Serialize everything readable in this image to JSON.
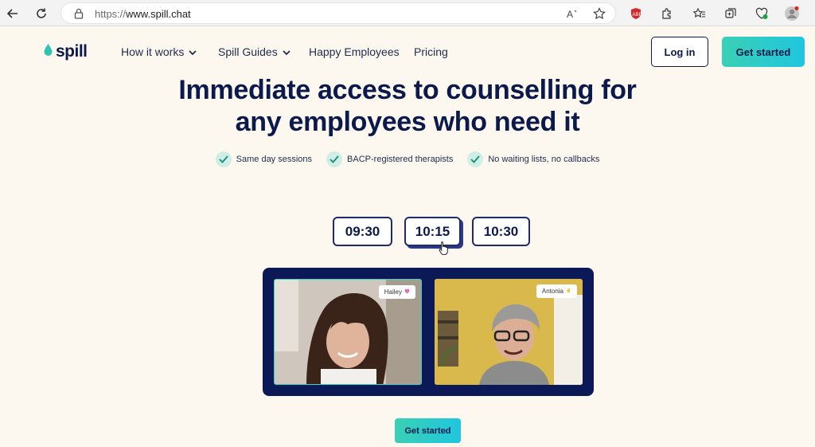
{
  "browser": {
    "url_protocol": "https://",
    "url_host": "www.spill.chat"
  },
  "site": {
    "logo_text": "spill",
    "nav": [
      {
        "label": "How it works",
        "has_dropdown": true
      },
      {
        "label": "Spill Guides",
        "has_dropdown": true
      },
      {
        "label": "Happy Employees",
        "has_dropdown": false
      },
      {
        "label": "Pricing",
        "has_dropdown": false
      }
    ],
    "login_label": "Log in",
    "get_started_label": "Get started"
  },
  "hero": {
    "line1": "Immediate access to counselling for",
    "line2": "any employees who need it",
    "features": [
      "Same day sessions",
      "BACP-registered therapists",
      "No waiting lists, no callbacks"
    ]
  },
  "slots": [
    "09:30",
    "10:15",
    "10:30"
  ],
  "video": {
    "left_name": "Hailey",
    "right_name": "Antonia"
  },
  "bottom_cta_label": "Get started",
  "colors": {
    "brand_navy": "#0b1a4a",
    "accent_teal": "#3ad0b5",
    "accent_cyan": "#1fc6df",
    "page_bg": "#fdf8ef"
  }
}
